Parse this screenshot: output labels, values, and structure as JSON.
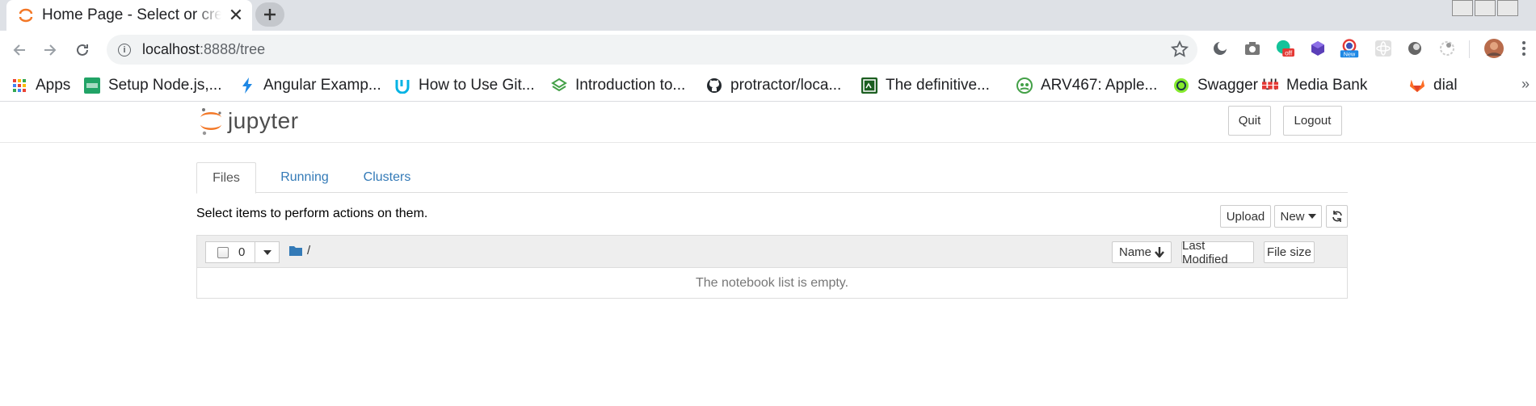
{
  "browser": {
    "tab_title": "Home Page - Select or create a notebook",
    "url_host": "localhost",
    "url_rest": ":8888/tree",
    "bookmarks": [
      {
        "label": "Apps",
        "icon": "apps-grid-icon"
      },
      {
        "label": "Setup Node.js,...",
        "icon": "djam-icon"
      },
      {
        "label": "Angular Examp...",
        "icon": "lightning-icon"
      },
      {
        "label": "How to Use Git...",
        "icon": "udacity-icon"
      },
      {
        "label": "Introduction to...",
        "icon": "layers-icon"
      },
      {
        "label": "protractor/loca...",
        "icon": "github-icon"
      },
      {
        "label": "The definitive...",
        "icon": "terminal-icon"
      },
      {
        "label": "ARV467: Apple...",
        "icon": "people-icon"
      },
      {
        "label": "Swagger UI",
        "icon": "swagger-icon"
      },
      {
        "label": "Media Bank",
        "icon": "abb-icon"
      },
      {
        "label": "dial",
        "icon": "gitlab-icon"
      }
    ],
    "ext_badges": {
      "off": "off",
      "new": "New"
    },
    "bookmarks_more": "»"
  },
  "jupyter": {
    "logo_text": "jupyter",
    "quit_label": "Quit",
    "logout_label": "Logout",
    "tabs": [
      {
        "label": "Files",
        "active": true
      },
      {
        "label": "Running",
        "active": false
      },
      {
        "label": "Clusters",
        "active": false
      }
    ],
    "hint": "Select items to perform actions on them.",
    "upload_label": "Upload",
    "new_label": "New",
    "selected_count": "0",
    "breadcrumb": "/",
    "columns": {
      "name": "Name",
      "modified": "Last Modified",
      "size": "File size"
    },
    "empty_message": "The notebook list is empty."
  },
  "colors": {
    "link": "#337ab7",
    "logo_orange": "#f37726",
    "folder": "#337ab7"
  }
}
